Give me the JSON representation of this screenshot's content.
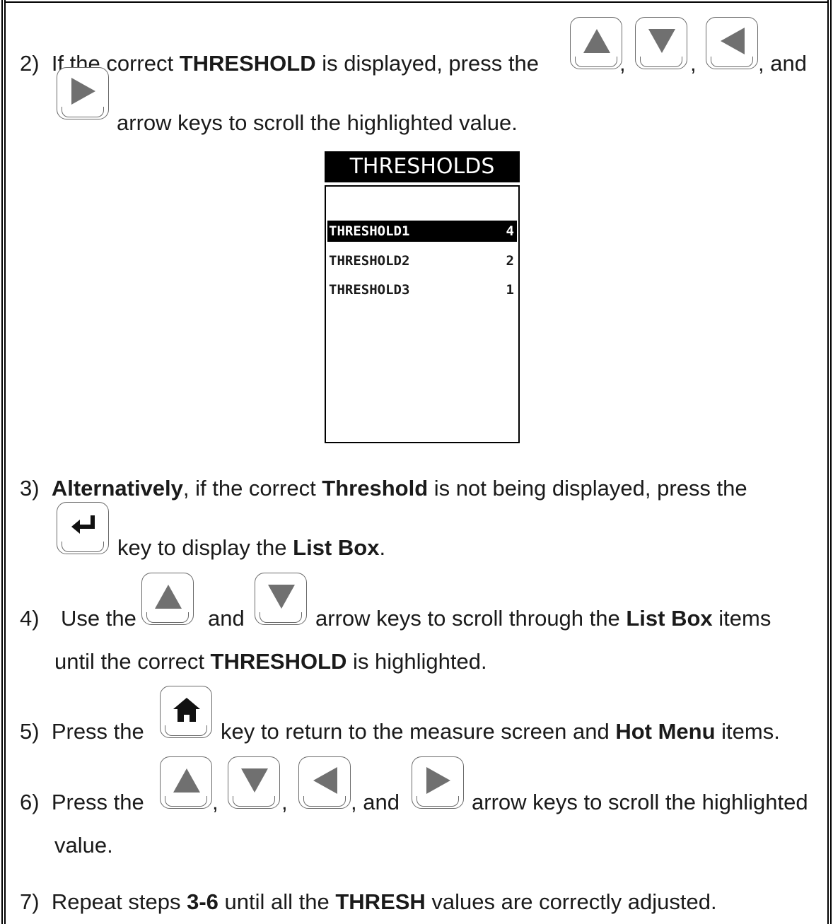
{
  "steps": [
    {
      "num": "2)",
      "a_pre": "If the correct ",
      "a_bold": "THRESHOLD",
      "a_post": " is displayed, press the",
      "c1": ",",
      "c2": ",",
      "and": ", and",
      "b_text": "arrow keys to scroll the highlighted value."
    },
    {
      "num": "3)",
      "bold1": "Alternatively",
      "mid": ", if the correct ",
      "bold2": "Threshold",
      "post": " is not being displayed, press the",
      "l2_pre": "key to display the ",
      "l2_bold": "List Box",
      "l2_post": "."
    },
    {
      "num": "4)",
      "pre": "Use the",
      "and": "and",
      "post": "arrow keys to scroll through the ",
      "bold": "List Box",
      "post2": " items",
      "l2_pre": "until the correct ",
      "l2_bold": "THRESHOLD",
      "l2_post": " is highlighted."
    },
    {
      "num": "5)",
      "pre": "Press the",
      "post": "key to return to the measure screen and ",
      "bold": "Hot Menu",
      "post2": " items."
    },
    {
      "num": "6)",
      "pre": "Press the",
      "c1": ",",
      "c2": ",",
      "and": ", and",
      "post": "arrow keys to scroll the highlighted",
      "l2": "value."
    },
    {
      "num": "7)",
      "pre": "Repeat steps ",
      "bold1": "3-6",
      "mid": " until all the ",
      "bold2": "THRESH",
      "post": " values are correctly adjusted."
    }
  ],
  "screen": {
    "title": "THRESHOLDS",
    "items": [
      {
        "name": "THRESHOLD1",
        "value": "4",
        "selected": true
      },
      {
        "name": "THRESHOLD2",
        "value": "2",
        "selected": false
      },
      {
        "name": "THRESHOLD3",
        "value": "1",
        "selected": false
      }
    ]
  },
  "icons": [
    "up-arrow-key-icon",
    "down-arrow-key-icon",
    "left-arrow-key-icon",
    "right-arrow-key-icon",
    "enter-key-icon",
    "home-key-icon"
  ],
  "colors": {
    "key_glyph": "#707070",
    "key_border": "#6a6a6a",
    "text": "#1a1a1a"
  }
}
